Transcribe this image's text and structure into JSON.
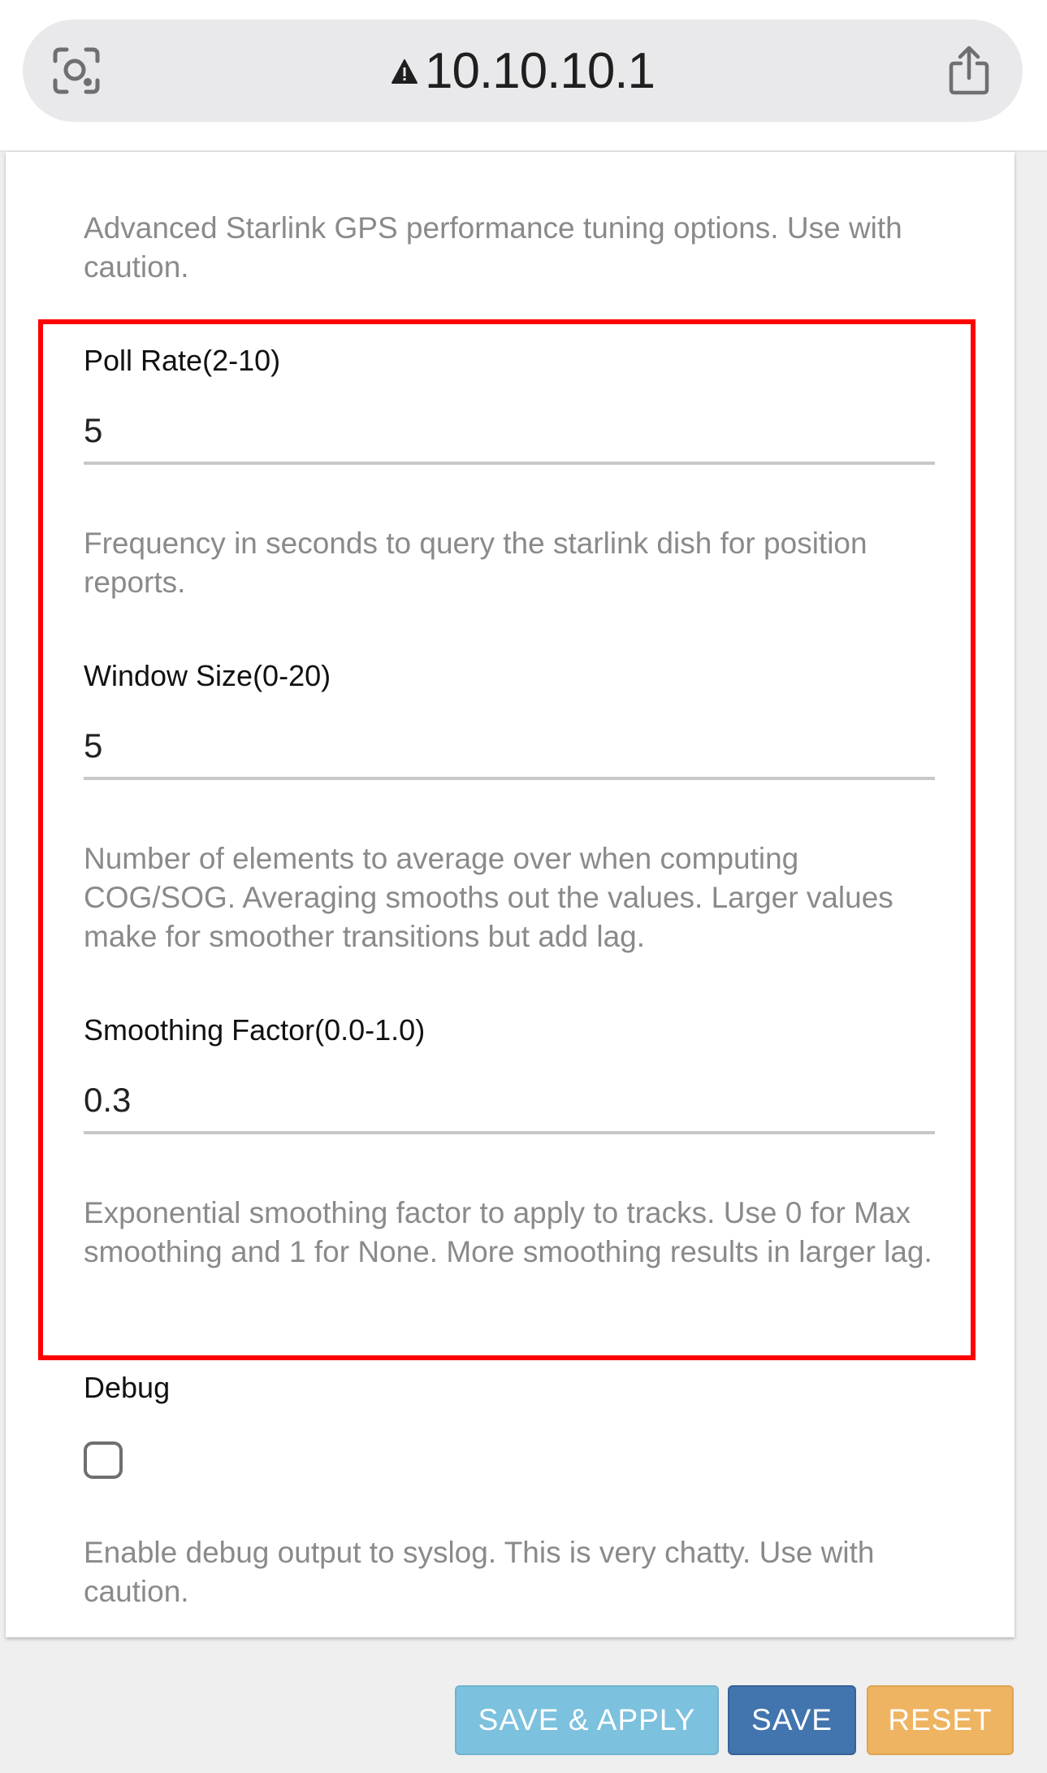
{
  "browser": {
    "url": "10.10.10.1",
    "icons": [
      "visual-lookup-icon",
      "warning-icon",
      "share-icon"
    ]
  },
  "section": {
    "description": "Advanced Starlink GPS performance tuning options. Use with caution."
  },
  "fields": {
    "poll_rate": {
      "label": "Poll Rate(2-10)",
      "value": "5",
      "help": "Frequency in seconds to query the starlink dish for position reports."
    },
    "window_size": {
      "label": "Window Size(0-20)",
      "value": "5",
      "help": "Number of elements to average over when computing COG/SOG. Averaging smooths out the values. Larger values make for smoother transitions but add lag."
    },
    "smoothing_factor": {
      "label": "Smoothing Factor(0.0-1.0)",
      "value": "0.3",
      "help": "Exponential smoothing factor to apply to tracks. Use 0 for Max smoothing and 1 for None. More smoothing results in larger lag."
    },
    "debug": {
      "label": "Debug",
      "checked": false,
      "help": "Enable debug output to syslog. This is very chatty. Use with caution."
    }
  },
  "buttons": {
    "save_apply": "SAVE & APPLY",
    "save": "SAVE",
    "reset": "RESET"
  },
  "colors": {
    "highlight": "#ff0000",
    "save_apply": "#7cc1de",
    "save": "#4274ae",
    "reset": "#eeb462"
  }
}
